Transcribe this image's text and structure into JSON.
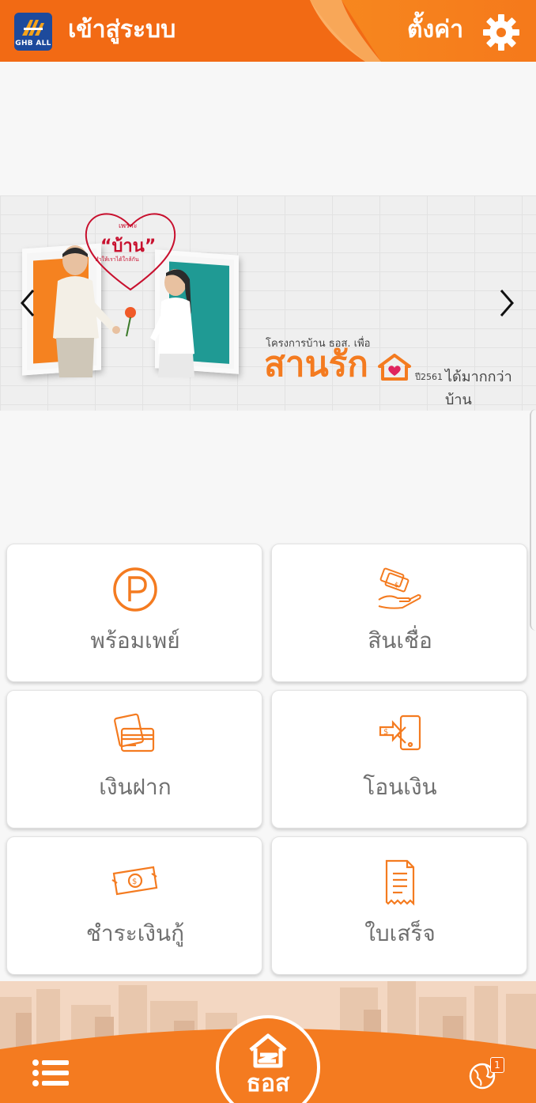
{
  "header": {
    "logo_text": "GHB ALL",
    "login_label": "เข้าสู่ระบบ",
    "settings_label": "ตั้งค่า",
    "settings_icon": "gear-icon",
    "brand_color": "#f26a14"
  },
  "banner": {
    "heart_small": "เพราะ",
    "heart_big": "“บ้าน”",
    "heart_caption": "ทำให้เราได้ใกล้กัน",
    "sub": "โครงการบ้าน ธอส. เพื่อ",
    "main": "สานรัก",
    "year": "ปี2561",
    "tagline": "ได้มากกว่าบ้าน",
    "prev_icon": "chevron-left-icon",
    "next_icon": "chevron-right-icon"
  },
  "tiles": [
    {
      "label": "พร้อมเพย์",
      "icon": "promptpay-icon"
    },
    {
      "label": "สินเชื่อ",
      "icon": "loan-icon"
    },
    {
      "label": "เงินฝาก",
      "icon": "deposit-card-icon"
    },
    {
      "label": "โอนเงิน",
      "icon": "transfer-icon"
    },
    {
      "label": "ชำระเงินกู้",
      "icon": "pay-loan-icon"
    },
    {
      "label": "ใบเสร็จ",
      "icon": "receipt-icon"
    }
  ],
  "footer": {
    "menu_icon": "list-icon",
    "ghb_label": "ธอส",
    "globe_icon": "globe-icon",
    "badge_count": "1",
    "accent": "#f47b20"
  }
}
